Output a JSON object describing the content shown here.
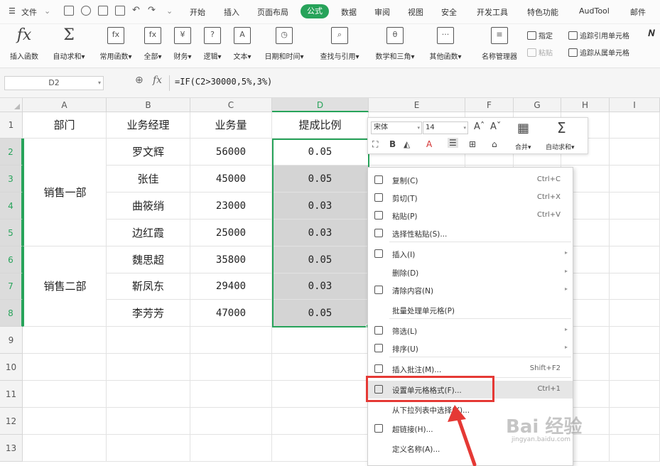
{
  "menubar": {
    "file": "文件",
    "tabs": [
      "开始",
      "插入",
      "页面布局",
      "公式",
      "数据",
      "审阅",
      "视图",
      "安全",
      "开发工具",
      "特色功能",
      "AudTool",
      "邮件"
    ],
    "active_tab": "公式"
  },
  "ribbon": {
    "insert_function": "插入函数",
    "autosum": "自动求和",
    "common": "常用函数",
    "all": "全部",
    "finance": "财务",
    "logic": "逻辑",
    "text": "文本",
    "datetime": "日期和时间",
    "lookup": "查找与引用",
    "math": "数学和三角",
    "other": "其他函数",
    "name_manager": "名称管理器",
    "specify": "指定",
    "paste": "粘贴",
    "trace_precedents": "追踪引用单元格",
    "trace_dependents": "追踪从属单元格"
  },
  "formula_bar": {
    "namebox": "D2",
    "fx": "fx",
    "formula": "=IF(C2>30000,5%,3%)"
  },
  "sheet": {
    "columns": [
      "A",
      "B",
      "C",
      "D",
      "E",
      "F",
      "G",
      "H",
      "I"
    ],
    "rows": [
      "1",
      "2",
      "3",
      "4",
      "5",
      "6",
      "7",
      "8",
      "9",
      "10",
      "11",
      "12",
      "13"
    ],
    "headers": [
      "部门",
      "业务经理",
      "业务量",
      "提成比例"
    ],
    "dept1": "销售一部",
    "dept2": "销售二部",
    "data": [
      [
        "罗文辉",
        "56000",
        "0.05"
      ],
      [
        "张佳",
        "45000",
        "0.05"
      ],
      [
        "曲筱绡",
        "23000",
        "0.03"
      ],
      [
        "边红霞",
        "25000",
        "0.03"
      ],
      [
        "魏思超",
        "35800",
        "0.05"
      ],
      [
        "靳凤东",
        "29400",
        "0.03"
      ],
      [
        "李芳芳",
        "47000",
        "0.05"
      ]
    ]
  },
  "mini_toolbar": {
    "font": "宋体",
    "size": "14",
    "merge": "合并",
    "autosum": "自动求和"
  },
  "context_menu": [
    {
      "label": "复制(C)",
      "shortcut": "Ctrl+C",
      "icon": "copy-icon"
    },
    {
      "label": "剪切(T)",
      "shortcut": "Ctrl+X",
      "icon": "scissors-icon"
    },
    {
      "label": "粘贴(P)",
      "shortcut": "Ctrl+V",
      "icon": "paste-icon"
    },
    {
      "label": "选择性粘贴(S)...",
      "shortcut": "",
      "icon": "paste-special-icon"
    },
    {
      "label": "插入(I)",
      "shortcut": "",
      "icon": "insert-icon"
    },
    {
      "label": "删除(D)",
      "shortcut": "",
      "icon": ""
    },
    {
      "label": "清除内容(N)",
      "shortcut": "",
      "icon": "eraser-icon"
    },
    {
      "label": "批量处理单元格(P)",
      "shortcut": "",
      "icon": ""
    },
    {
      "label": "筛选(L)",
      "shortcut": "",
      "icon": "filter-icon"
    },
    {
      "label": "排序(U)",
      "shortcut": "",
      "icon": "sort-icon"
    },
    {
      "label": "插入批注(M)...",
      "shortcut": "Shift+F2",
      "icon": "comment-icon"
    },
    {
      "label": "设置单元格格式(F)...",
      "shortcut": "Ctrl+1",
      "icon": "format-cells-icon"
    },
    {
      "label": "从下拉列表中选择(K)...",
      "shortcut": "",
      "icon": ""
    },
    {
      "label": "超链接(H)...",
      "shortcut": "",
      "icon": "link-icon"
    },
    {
      "label": "定义名称(A)...",
      "shortcut": "",
      "icon": ""
    }
  ],
  "watermark": {
    "brand": "Bai 经验",
    "url": "jingyan.baidu.com"
  },
  "colors": {
    "accent": "#27a35a",
    "highlight_box": "#e53935",
    "selection_fill": "#d4d4d4"
  }
}
